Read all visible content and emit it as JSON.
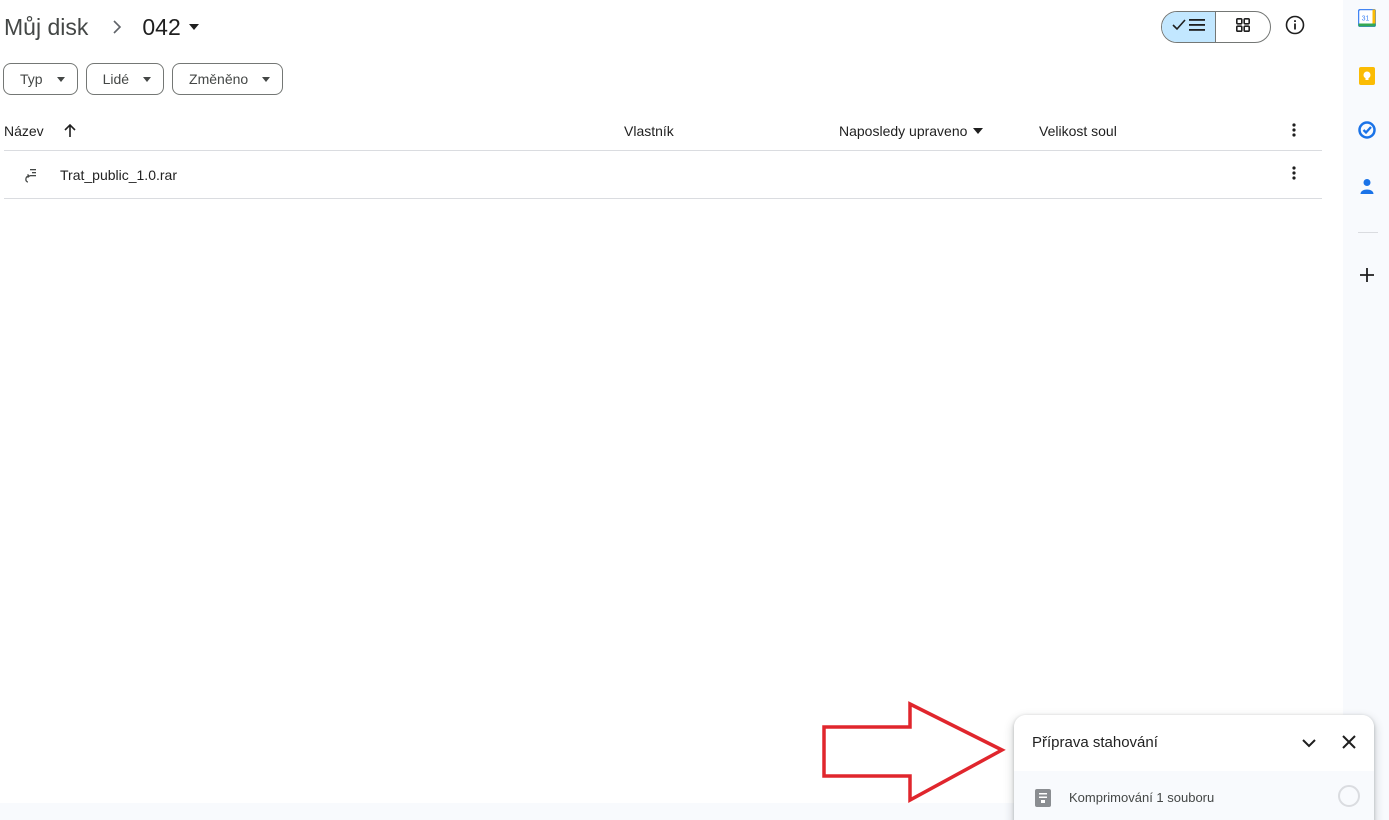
{
  "breadcrumb": {
    "root": "Můj disk",
    "current": "042"
  },
  "filters": [
    {
      "label": "Typ"
    },
    {
      "label": "Lidé"
    },
    {
      "label": "Změněno"
    }
  ],
  "table": {
    "columns": {
      "name": "Název",
      "owner": "Vlastník",
      "modified": "Naposledy upraveno",
      "size": "Velikost soul"
    },
    "rows": [
      {
        "name": "Trat_public_1.0.rar",
        "icon": "archive-file-icon"
      }
    ]
  },
  "side_panel": {
    "calendar_badge": "31",
    "icons": [
      "calendar-icon",
      "keep-icon",
      "tasks-icon",
      "contacts-icon",
      "add-icon"
    ]
  },
  "download_panel": {
    "title": "Příprava stahování",
    "item_text": "Komprimování 1 souboru"
  },
  "colors": {
    "toggle_active": "#c2e7ff",
    "annotation_arrow": "#e0262d",
    "calendar_blue": "#4285f4",
    "keep_yellow": "#fbbc04",
    "tasks_blue": "#1a73e8",
    "contacts_blue": "#1a73e8"
  }
}
